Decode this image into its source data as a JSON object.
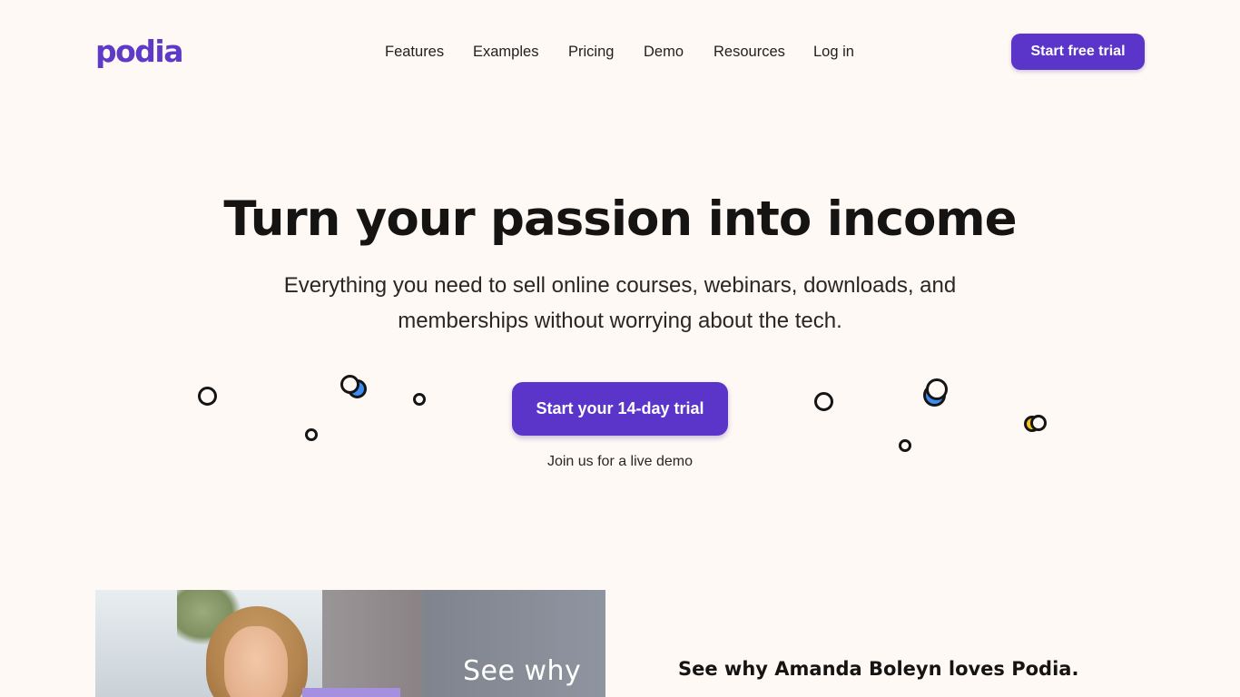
{
  "header": {
    "logo": "podia",
    "nav": [
      "Features",
      "Examples",
      "Pricing",
      "Demo",
      "Resources",
      "Log in"
    ],
    "cta_label": "Start free trial"
  },
  "hero": {
    "title": "Turn your passion into income",
    "subtitle": "Everything you need to sell online courses, webinars, downloads, and memberships without worrying about the tech.",
    "cta_label": "Start your 14-day trial",
    "demo_link": "Join us for a live demo"
  },
  "testimonial": {
    "video_overlay_text": "See why",
    "title": "See why Amanda Boleyn loves Podia."
  },
  "colors": {
    "brand": "#5b35c9",
    "background": "#fef9f5",
    "accent_blue": "#3b8ef0",
    "accent_yellow": "#f5c518"
  }
}
